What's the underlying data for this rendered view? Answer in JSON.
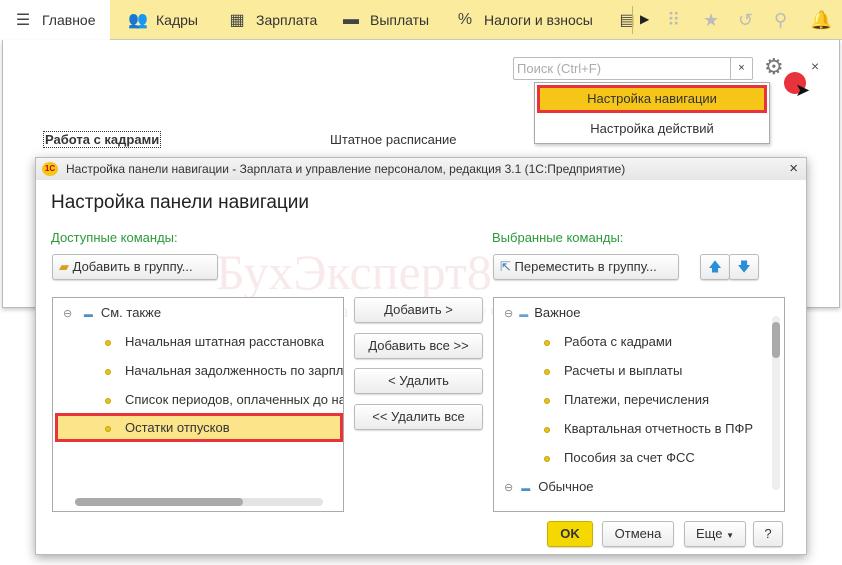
{
  "topbar": {
    "items": [
      {
        "label": "Главное",
        "icon": "hamburger-icon"
      },
      {
        "label": "Кадры",
        "icon": "people-icon"
      },
      {
        "label": "Зарплата",
        "icon": "calculator-icon"
      },
      {
        "label": "Выплаты",
        "icon": "wallet-icon"
      },
      {
        "label": "Налоги и взносы",
        "icon": "percent-icon"
      }
    ]
  },
  "background": {
    "search_placeholder": "Поиск (Ctrl+F)",
    "clear": "×",
    "close": "×",
    "link1": "Работа с кадрами",
    "link2": "Штатное расписание"
  },
  "menu": {
    "items": [
      "Настройка навигации",
      "Настройка действий"
    ]
  },
  "dialog": {
    "window_title": "Настройка панели навигации - Зарплата и управление персоналом, редакция 3.1  (1С:Предприятие)",
    "close": "×",
    "heading": "Настройка панели навигации",
    "available_label": "Доступные команды:",
    "selected_label": "Выбранные команды:",
    "add_to_group": "Добавить в группу...",
    "move_to_group": "Переместить в группу...",
    "available": {
      "group": "См. также",
      "items": [
        "Начальная штатная расстановка",
        "Начальная задолженность по зарплате",
        "Список периодов, оплаченных до начала",
        "Остатки отпусков"
      ]
    },
    "actions": [
      "Добавить >",
      "Добавить все >>",
      "< Удалить",
      "<< Удалить все"
    ],
    "selected": {
      "group1": "Важное",
      "items": [
        "Работа с кадрами",
        "Расчеты и выплаты",
        "Платежи, перечисления",
        "Квартальная отчетность в ПФР",
        "Пособия за счет ФСС"
      ],
      "group2": "Обычное"
    },
    "ok": "OK",
    "cancel": "Отмена",
    "more": "Еще",
    "help": "?"
  },
  "watermark": {
    "title": "БухЭксперт8",
    "subtitle": "База ответов по учёту в 1С"
  },
  "colors": {
    "accent": "#fbec9d",
    "highlight": "#f5c518",
    "ok": "#f5d800",
    "red": "#e8333a",
    "green": "#2a9a3a"
  }
}
